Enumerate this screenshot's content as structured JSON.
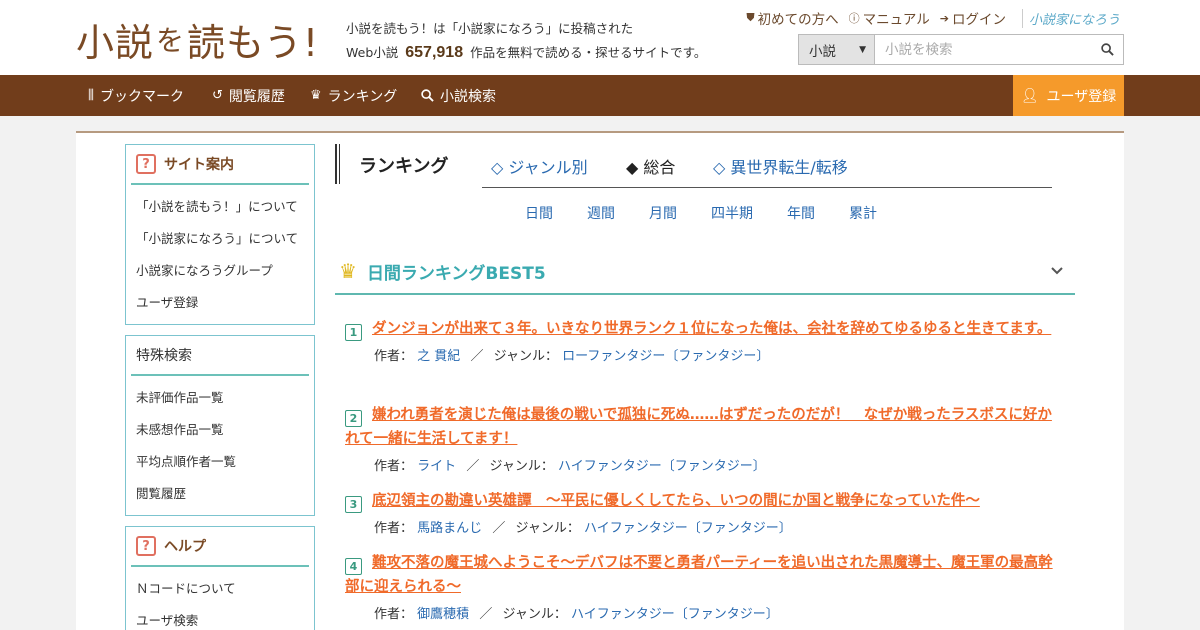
{
  "header": {
    "logo_part1": "小説",
    "logo_part2": "を",
    "logo_part3": "読もう!",
    "tagline_line1": "小説を読もう！は「小説家になろう」に投稿された",
    "tagline_prefix": "Web小説",
    "novel_count": "657,918",
    "tagline_suffix": "作品を無料で読める・探せるサイトです。",
    "links": [
      {
        "label": "初めての方へ",
        "icon": "shield-icon"
      },
      {
        "label": "マニュアル",
        "icon": "question-circle-icon"
      },
      {
        "label": "ログイン",
        "icon": "login-icon"
      }
    ],
    "narou_logo": "小説家になろう",
    "search": {
      "category": "小説",
      "placeholder": "小説を検索"
    }
  },
  "nav": {
    "items": [
      {
        "label": "ブックマーク",
        "icon": "bookmark-icon"
      },
      {
        "label": "閲覧履歴",
        "icon": "history-icon"
      },
      {
        "label": "ランキング",
        "icon": "crown-icon"
      },
      {
        "label": "小説検索",
        "icon": "search-icon"
      }
    ],
    "register": "ユーザ登録"
  },
  "sidebar": {
    "guide": {
      "title": "サイト案内",
      "items": [
        "「小説を読もう！」について",
        "「小説家になろう」について",
        "小説家になろうグループ",
        "ユーザ登録"
      ]
    },
    "special": {
      "title": "特殊検索",
      "items": [
        "未評価作品一覧",
        "未感想作品一覧",
        "平均点順作者一覧",
        "閲覧履歴"
      ]
    },
    "help": {
      "title": "ヘルプ",
      "items": [
        "Ｎコードについて",
        "ユーザ検索"
      ]
    }
  },
  "main": {
    "title": "ランキング",
    "tabs": [
      {
        "label": "◇ ジャンル別",
        "active": false
      },
      {
        "label": "◆ 総合",
        "active": true
      },
      {
        "label": "◇ 異世界転生/転移",
        "active": false
      }
    ],
    "periods": [
      "日間",
      "週間",
      "月間",
      "四半期",
      "年間",
      "累計"
    ],
    "section_title": "日間ランキングBEST5",
    "author_label": "作者：",
    "genre_label": "ジャンル：",
    "separator": "／",
    "rankings": [
      {
        "num": "1",
        "title": "ダンジョンが出来て３年。いきなり世界ランク１位になった俺は、会社を辞めてゆるゆると生きてます。",
        "author": "之 貫紀",
        "genre": "ローファンタジー〔ファンタジー〕"
      },
      {
        "num": "2",
        "title": "嫌われ勇者を演じた俺は最後の戦いで孤独に死ぬ……はずだったのだが！　なぜか戦ったラスボスに好かれて一緒に生活してます！",
        "author": "ライト",
        "genre": "ハイファンタジー〔ファンタジー〕"
      },
      {
        "num": "3",
        "title": "底辺領主の勘違い英雄譚　～平民に優しくしてたら、いつの間にか国と戦争になっていた件～",
        "author": "馬路まんじ",
        "genre": "ハイファンタジー〔ファンタジー〕"
      },
      {
        "num": "4",
        "title": "難攻不落の魔王城へようこそ～デバフは不要と勇者パーティーを追い出された黒魔導士、魔王軍の最高幹部に迎えられる～",
        "author": "御鷹穂積",
        "genre": "ハイファンタジー〔ファンタジー〕"
      }
    ]
  }
}
